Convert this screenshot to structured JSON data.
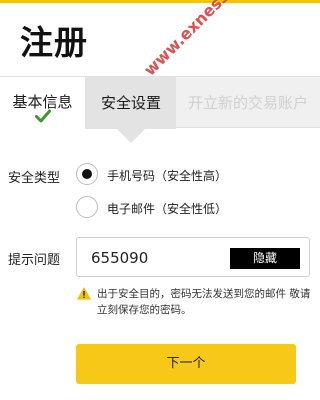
{
  "header": {
    "title": "注册"
  },
  "watermark": {
    "text": "www.exness.xin"
  },
  "steps": [
    {
      "label": "基本信息",
      "state": "completed"
    },
    {
      "label": "安全设置",
      "state": "active"
    },
    {
      "label": "开立新的交易账户",
      "state": "upcoming"
    }
  ],
  "security_type": {
    "label": "安全类型",
    "options": [
      {
        "label": "手机号码（安全性高）",
        "selected": true
      },
      {
        "label": "电子邮件（安全性低）",
        "selected": false
      }
    ]
  },
  "question": {
    "label": "提示问题",
    "value": "655090",
    "hide_label": "隐藏"
  },
  "warning": {
    "text": "出于安全目的，密码无法发送到您的邮件 敬请立刻保存您的密码。"
  },
  "next_label": "下一个",
  "colors": {
    "accent": "#f7c817",
    "watermark": "#e23b3b",
    "check": "#3a9a2c"
  }
}
